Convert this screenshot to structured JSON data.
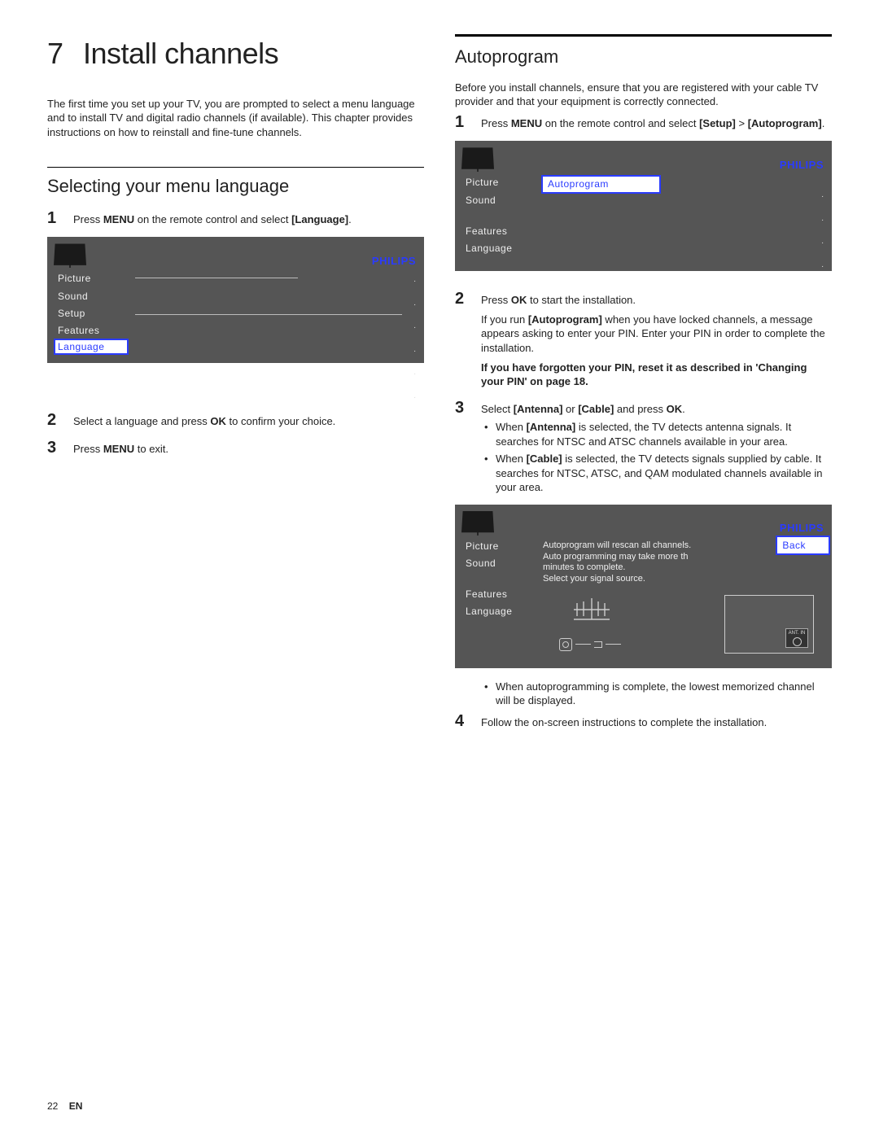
{
  "chapter": {
    "num": "7",
    "title": "Install channels"
  },
  "intro": "The first time you set up your TV, you are prompted to select a menu language and to install TV and digital radio channels (if available). This chapter provides instructions on how to reinstall and fine-tune channels.",
  "left": {
    "section_title": "Selecting your menu language",
    "step1_a": "Press ",
    "step1_menu": "MENU",
    "step1_b": " on the remote control and select ",
    "step1_lang": "[Language]",
    "step1_c": ".",
    "step2_a": "Select a language and press ",
    "step2_ok": "OK",
    "step2_b": " to confirm your choice.",
    "step3_a": "Press ",
    "step3_menu": "MENU",
    "step3_b": " to exit.",
    "menu": {
      "brand": "PHILIPS",
      "items": [
        "Picture",
        "Sound",
        "Setup",
        "Features",
        "Language"
      ],
      "selected": "Language"
    }
  },
  "right": {
    "section_title": "Autoprogram",
    "intro": "Before you install channels, ensure that you are registered with your cable TV provider and that your equipment is correctly connected.",
    "step1_a": "Press ",
    "step1_menu": "MENU",
    "step1_b": " on the remote control and select ",
    "step1_setup": "[Setup]",
    "step1_c": " > ",
    "step1_auto": "[Autoprogram]",
    "step1_d": ".",
    "menu1": {
      "brand": "PHILIPS",
      "items": [
        "Picture",
        "Sound",
        "",
        "Features",
        "Language"
      ],
      "right_selected": "Autoprogram"
    },
    "step2_a": "Press ",
    "step2_ok": "OK",
    "step2_b": " to start the installation.",
    "note1_a": "If you run ",
    "note1_auto": "[Autoprogram]",
    "note1_b": " when you have locked channels, a message appears asking to enter your PIN. Enter your PIN in order to complete the installation.",
    "note2": "If you have forgotten your PIN, reset it as described in 'Changing your PIN' on page 18.",
    "step3_a": "Select ",
    "step3_ant": "[Antenna]",
    "step3_or": " or ",
    "step3_cab": "[Cable]",
    "step3_b": " and press ",
    "step3_ok": "OK",
    "step3_c": ".",
    "bullet1_a": "When ",
    "bullet1_ant": "[Antenna]",
    "bullet1_b": " is selected, the TV detects antenna signals. It searches for NTSC and ATSC channels available in your area.",
    "bullet2_a": "When ",
    "bullet2_cab": "[Cable]",
    "bullet2_b": " is selected, the TV detects signals supplied by cable. It searches for NTSC, ATSC, and QAM modulated channels available in your area.",
    "menu2": {
      "brand": "PHILIPS",
      "items": [
        "Picture",
        "Sound",
        "",
        "Features",
        "Language"
      ],
      "back": "Back",
      "msg1": "Autoprogram will rescan all channels.",
      "msg2": "Auto programming  may take more th",
      "msg3": "minutes to complete.",
      "msg4": "Select your signal source.",
      "antport": "ANT. IN"
    },
    "bullet3": "When autoprogramming is complete, the lowest memorized channel will be displayed.",
    "step4": "Follow the on-screen instructions to complete the installation."
  },
  "footer": {
    "page": "22",
    "lang": "EN"
  }
}
